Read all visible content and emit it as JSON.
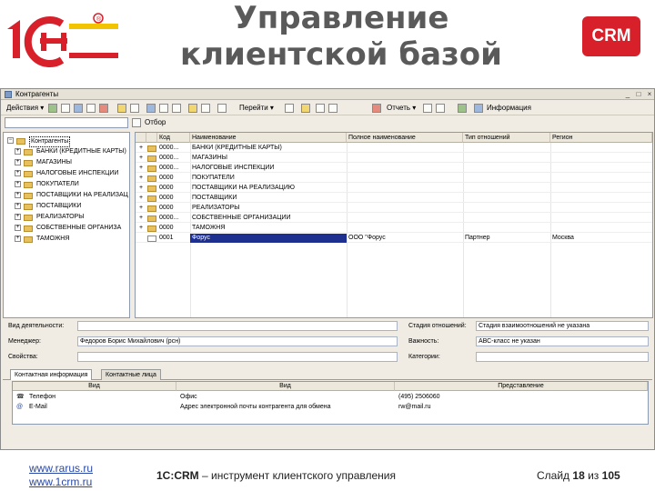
{
  "slide": {
    "title_line1": "Управление",
    "title_line2": "клиентской базой",
    "logo_text": "1С",
    "badge_text": "CRM",
    "footer": {
      "link1": "www.rarus.ru",
      "link2": "www.1crm.ru",
      "center_bold": "1С:CRM",
      "center_rest": " – инструмент клиентского управления",
      "slide_label": "Слайд",
      "slide_number": "18",
      "slide_of": "из",
      "slide_total": "105"
    }
  },
  "window": {
    "title": "Контрагенты",
    "toolbar": {
      "actions": "Действия ▾",
      "goto": "Перейти ▾",
      "report": "Отчеть ▾",
      "info": "Информация"
    },
    "search": {
      "value": "",
      "btn": "Отбор"
    },
    "tree": [
      {
        "label": "Контрагенты",
        "level": 0
      },
      {
        "label": "БАНКИ (КРЕДИТНЫЕ КАРТЫ)",
        "level": 1
      },
      {
        "label": "МАГАЗИНЫ",
        "level": 1
      },
      {
        "label": "НАЛОГОВЫЕ ИНСПЕКЦИИ",
        "level": 1
      },
      {
        "label": "ПОКУПАТЕЛИ",
        "level": 1
      },
      {
        "label": "ПОСТАВЩИКИ НА РЕАЛИЗАЦ",
        "level": 1
      },
      {
        "label": "ПОСТАВЩИКИ",
        "level": 1
      },
      {
        "label": "РЕАЛИЗАТОРЫ",
        "level": 1
      },
      {
        "label": "СОБСТВЕННЫЕ ОРГАНИЗА",
        "level": 1
      },
      {
        "label": "ТАМОЖНЯ",
        "level": 1
      }
    ],
    "grid": {
      "columns": [
        "Код",
        "Наименование",
        "Полное наименование",
        "Тип отношений",
        "Регион"
      ],
      "rows": [
        {
          "code": "0000...",
          "name": "БАНКИ (КРЕДИТНЫЕ КАРТЫ)",
          "full": "",
          "type": "",
          "region": ""
        },
        {
          "code": "0000...",
          "name": "МАГАЗИНЫ",
          "full": "",
          "type": "",
          "region": ""
        },
        {
          "code": "0000...",
          "name": "НАЛОГОВЫЕ ИНСПЕКЦИИ",
          "full": "",
          "type": "",
          "region": ""
        },
        {
          "code": "0000",
          "name": "ПОКУПАТЕЛИ",
          "full": "",
          "type": "",
          "region": ""
        },
        {
          "code": "0000",
          "name": "ПОСТАВЩИКИ НА РЕАЛИЗАЦИЮ",
          "full": "",
          "type": "",
          "region": ""
        },
        {
          "code": "0000",
          "name": "ПОСТАВЩИКИ",
          "full": "",
          "type": "",
          "region": ""
        },
        {
          "code": "0000",
          "name": "РЕАЛИЗАТОРЫ",
          "full": "",
          "type": "",
          "region": ""
        },
        {
          "code": "0000...",
          "name": "СОБСТВЕННЫЕ ОРГАНИЗАЦИИ",
          "full": "",
          "type": "",
          "region": ""
        },
        {
          "code": "0000",
          "name": "ТАМОЖНЯ",
          "full": "",
          "type": "",
          "region": ""
        },
        {
          "code": "0001",
          "name": "Форус",
          "full": "ООО \"Форус",
          "type": "Партнер",
          "region": "Москва"
        }
      ]
    },
    "detail": {
      "activity_label": "Вид деятельности:",
      "activity_value": "",
      "manager_label": "Менеджер:",
      "manager_value": "Федоров Борис Михайлович (рсн)",
      "props_label": "Свойства:",
      "props_value": "",
      "stage_label": "Стадия отношений:",
      "stage_value": "Стадия взаимоотношений не указана",
      "importance_label": "Важность:",
      "importance_value": "АВС-класс не указан",
      "categories_label": "Категории:",
      "categories_value": ""
    },
    "tabs": [
      "Контактная информация",
      "Контактные лица"
    ],
    "contacts": {
      "columns": [
        "Вид",
        "Вид",
        "Представление"
      ],
      "rows": [
        {
          "kind": "Телефон",
          "type": "Офис",
          "value": "(495) 2506060"
        },
        {
          "kind": "E-Mail",
          "type": "Адрес электронной почты контрагента для обмена",
          "value": "rw@mail.ru"
        }
      ]
    }
  },
  "colors": {
    "brand_red": "#d7202a",
    "selection": "#1d2f8f",
    "title_gray": "#5a5a5a",
    "link_blue": "#2a49a6"
  }
}
